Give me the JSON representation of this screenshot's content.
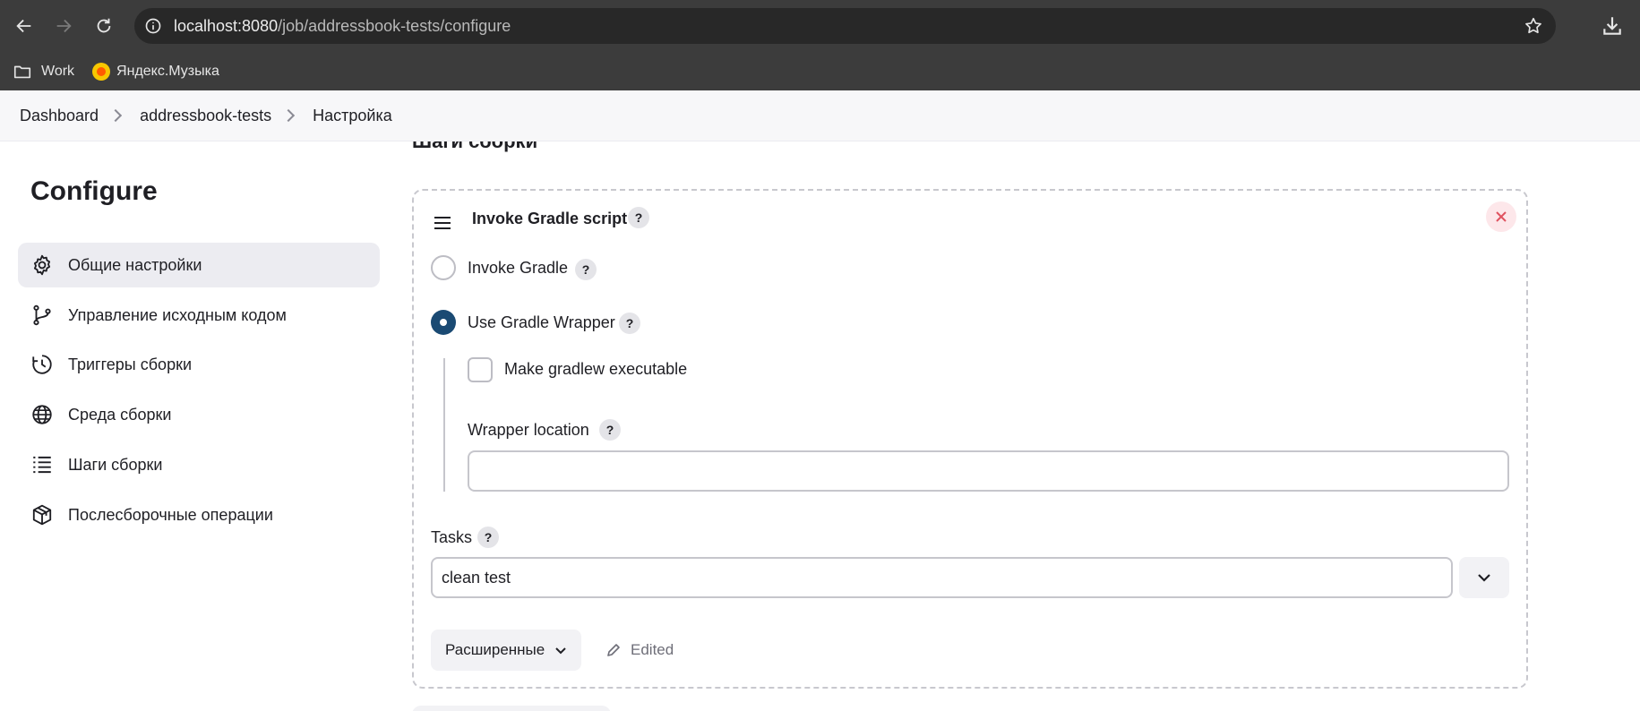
{
  "browser": {
    "url_host": "localhost:8080",
    "url_path": "/job/addressbook-tests/configure",
    "bookmarks": [
      {
        "label": "Work",
        "icon": "folder-icon"
      },
      {
        "label": "Яндекс.Музыка",
        "icon": "yandex-music-icon"
      }
    ]
  },
  "breadcrumb": [
    "Dashboard",
    "addressbook-tests",
    "Настройка"
  ],
  "sidebar": {
    "title": "Configure",
    "items": [
      {
        "label": "Общие настройки",
        "icon": "gear-icon",
        "active": true
      },
      {
        "label": "Управление исходным кодом",
        "icon": "branch-icon"
      },
      {
        "label": "Триггеры сборки",
        "icon": "clock-icon"
      },
      {
        "label": "Среда сборки",
        "icon": "globe-icon"
      },
      {
        "label": "Шаги сборки",
        "icon": "list-icon"
      },
      {
        "label": "Послесборочные операции",
        "icon": "package-icon"
      }
    ]
  },
  "main": {
    "section_title": "Шаги сборки",
    "step": {
      "title": "Invoke Gradle script",
      "help": "?",
      "radio_invoke_gradle": "Invoke Gradle",
      "radio_use_wrapper": "Use Gradle Wrapper",
      "selected_option": "Use Gradle Wrapper",
      "checkbox_make_executable": "Make gradlew executable",
      "wrapper_location_label": "Wrapper location",
      "wrapper_location_value": "",
      "tasks_label": "Tasks",
      "tasks_value": "clean test",
      "advanced_label": "Расширенные",
      "edited_label": "Edited"
    }
  },
  "colors": {
    "accent": "#1a4a73",
    "close_bg": "#fde7ea",
    "close_x": "#e0525f"
  }
}
